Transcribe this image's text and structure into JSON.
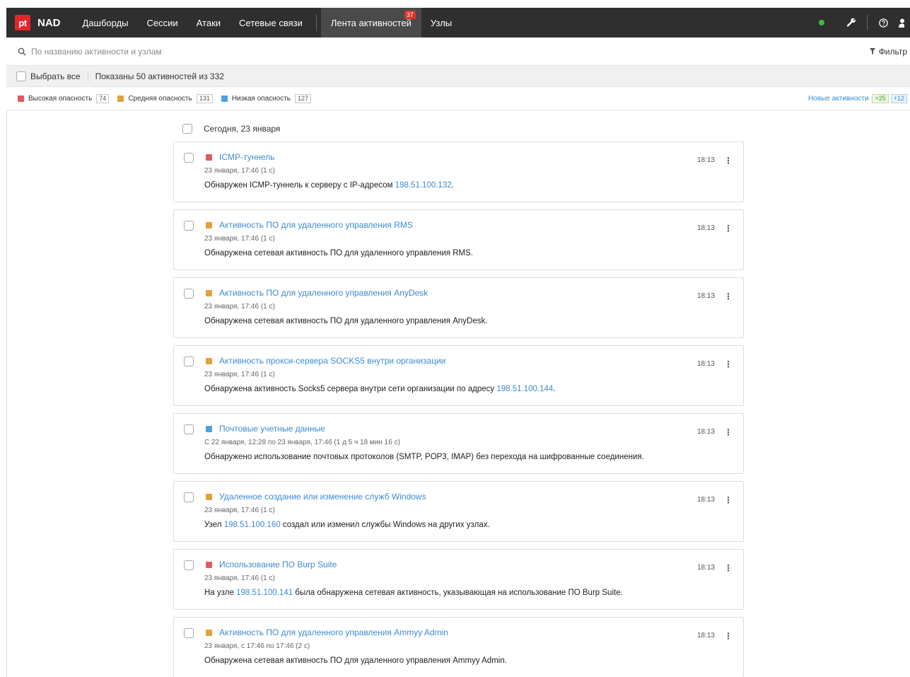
{
  "app": {
    "logo": "pt",
    "name": "NAD"
  },
  "nav": {
    "items": [
      "Дашборды",
      "Сессии",
      "Атаки",
      "Сетевые связи"
    ],
    "active": {
      "label": "Лента активностей",
      "badge": "37"
    },
    "nodes": "Узлы"
  },
  "search": {
    "placeholder": "По названию активности и узлам",
    "filter_label": "Фильтр"
  },
  "selection": {
    "select_all": "Выбрать все",
    "shown": "Показаны 50 активностей из 332"
  },
  "legend": {
    "high": {
      "label": "Высокая опасность",
      "count": "74",
      "color": "#e05c5c"
    },
    "medium": {
      "label": "Средняя опасность",
      "count": "131",
      "color": "#e0a33a"
    },
    "low": {
      "label": "Низкая опасность",
      "count": "127",
      "color": "#4f9fe0"
    },
    "new_label": "Новые активности",
    "new_count_1": "+25",
    "new_count_2": "+12"
  },
  "feed": {
    "date_header": "Сегодня, 23 января",
    "cards": [
      {
        "severity": "high",
        "color": "#e05c5c",
        "title": "ICMP-туннель",
        "sub": "23 января, 17:46 (1 с)",
        "time": "18:13",
        "desc_pre": "Обнаружен ICMP-туннель к серверу с IP-адресом ",
        "ip": "198.51.100.132",
        "desc_post": "."
      },
      {
        "severity": "medium",
        "color": "#e0a33a",
        "title": "Активность ПО для удаленного управления RMS",
        "sub": "23 января, 17:46 (1 с)",
        "time": "18:13",
        "desc_pre": "Обнаружена сетевая активность ПО для удаленного управления RMS.",
        "ip": "",
        "desc_post": ""
      },
      {
        "severity": "medium",
        "color": "#e0a33a",
        "title": "Активность ПО для удаленного управления AnyDesk",
        "sub": "23 января, 17:46 (1 с)",
        "time": "18:13",
        "desc_pre": "Обнаружена сетевая активность ПО для удаленного управления AnyDesk.",
        "ip": "",
        "desc_post": ""
      },
      {
        "severity": "medium",
        "color": "#e0a33a",
        "title": "Активность прокси-сервера SOCKS5 внутри организации",
        "sub": "23 января, 17:46 (1 с)",
        "time": "18:13",
        "desc_pre": "Обнаружена активность Socks5 сервера внутри сети организации по адресу ",
        "ip": "198.51.100.144",
        "desc_post": "."
      },
      {
        "severity": "low",
        "color": "#4f9fe0",
        "title": "Почтовые учетные данные",
        "sub": "С 22 января, 12:28 по 23 января, 17:46 (1 д 5 ч 18 мин 16 с)",
        "time": "18:13",
        "desc_pre": "Обнаружено использование почтовых протоколов (SMTP, POP3, IMAP) без перехода на шифрованные соединения.",
        "ip": "",
        "desc_post": ""
      },
      {
        "severity": "medium",
        "color": "#e0a33a",
        "title": "Удаленное создание или изменение служб Windows",
        "sub": "23 января, 17:46 (1 с)",
        "time": "18:13",
        "desc_pre": "Узел ",
        "ip": "198.51.100.160",
        "desc_post": " создал или изменил службы Windows на других узлах."
      },
      {
        "severity": "high",
        "color": "#e05c5c",
        "title": "Использование ПО Burp Suite",
        "sub": "23 января, 17:46 (1 с)",
        "time": "18:13",
        "desc_pre": "На узле ",
        "ip": "198.51.100.141",
        "desc_post": " была обнаружена сетевая активность, указывающая на использование ПО Burp Suite."
      },
      {
        "severity": "medium",
        "color": "#e0a33a",
        "title": "Активность ПО для удаленного управления Ammyy Admin",
        "sub": "23 января, с 17:46 по 17:46 (2 с)",
        "time": "18:13",
        "desc_pre": "Обнаружена сетевая активность ПО для удаленного управления Ammyy Admin.",
        "ip": "",
        "desc_post": ""
      }
    ]
  }
}
